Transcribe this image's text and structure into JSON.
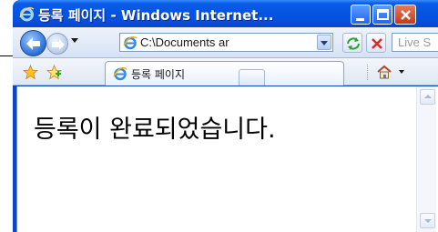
{
  "window": {
    "title": "등록 페이지 - Windows Internet...",
    "colors": {
      "titlebar": "#0555e0",
      "close": "#c7391a"
    }
  },
  "navbar": {
    "address": "C:\\Documents ar",
    "search_placeholder": "Live S"
  },
  "tabs": [
    {
      "label": "등록 페이지",
      "icon": "ie-page-icon",
      "active": true
    }
  ],
  "content": {
    "message": "등록이 완료되었습니다."
  }
}
